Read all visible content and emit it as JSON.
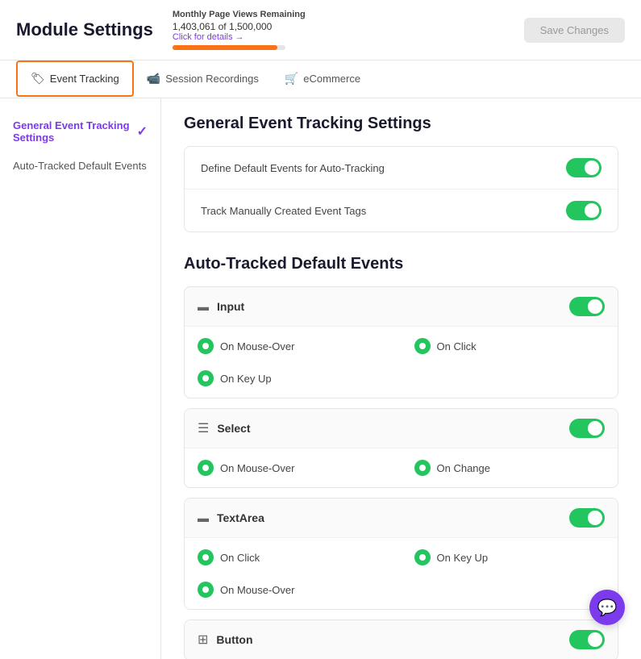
{
  "header": {
    "title": "Module Settings",
    "pageViews": {
      "label": "Monthly Page Views Remaining",
      "clickDetails": "Click for details →",
      "count": "1,403,061 of 1,500,000",
      "progressPercent": 93
    },
    "saveButton": "Save Changes"
  },
  "tabs": [
    {
      "id": "event-tracking",
      "label": "Event Tracking",
      "icon": "🏷",
      "active": true
    },
    {
      "id": "session-recordings",
      "label": "Session Recordings",
      "icon": "📹",
      "active": false
    },
    {
      "id": "ecommerce",
      "label": "eCommerce",
      "icon": "🛒",
      "active": false
    }
  ],
  "sidebar": {
    "items": [
      {
        "id": "general",
        "label": "General Event Tracking Settings",
        "active": true,
        "hasCheck": true
      },
      {
        "id": "auto-tracked",
        "label": "Auto-Tracked Default Events",
        "active": false,
        "hasCheck": false
      }
    ]
  },
  "main": {
    "generalSection": {
      "title": "General Event Tracking Settings",
      "settings": [
        {
          "id": "define-defaults",
          "label": "Define Default Events for Auto-Tracking",
          "enabled": true
        },
        {
          "id": "track-manually",
          "label": "Track Manually Created Event Tags",
          "enabled": true
        }
      ]
    },
    "autoTrackedSection": {
      "title": "Auto-Tracked Default Events",
      "events": [
        {
          "id": "input",
          "name": "Input",
          "icon": "▬",
          "enabled": true,
          "options": [
            {
              "id": "mouse-over",
              "label": "On Mouse-Over",
              "enabled": true
            },
            {
              "id": "on-click",
              "label": "On Click",
              "enabled": true
            },
            {
              "id": "key-up",
              "label": "On Key Up",
              "enabled": true
            }
          ]
        },
        {
          "id": "select",
          "name": "Select",
          "icon": "☰",
          "enabled": true,
          "options": [
            {
              "id": "mouse-over",
              "label": "On Mouse-Over",
              "enabled": true
            },
            {
              "id": "on-change",
              "label": "On Change",
              "enabled": true
            }
          ]
        },
        {
          "id": "textarea",
          "name": "TextArea",
          "icon": "▬",
          "enabled": true,
          "options": [
            {
              "id": "on-click",
              "label": "On Click",
              "enabled": true
            },
            {
              "id": "key-up",
              "label": "On Key Up",
              "enabled": true
            },
            {
              "id": "mouse-over",
              "label": "On Mouse-Over",
              "enabled": true
            }
          ]
        },
        {
          "id": "button",
          "name": "Button",
          "icon": "⊞",
          "enabled": true,
          "options": []
        }
      ]
    }
  },
  "chat": {
    "icon": "💬"
  }
}
